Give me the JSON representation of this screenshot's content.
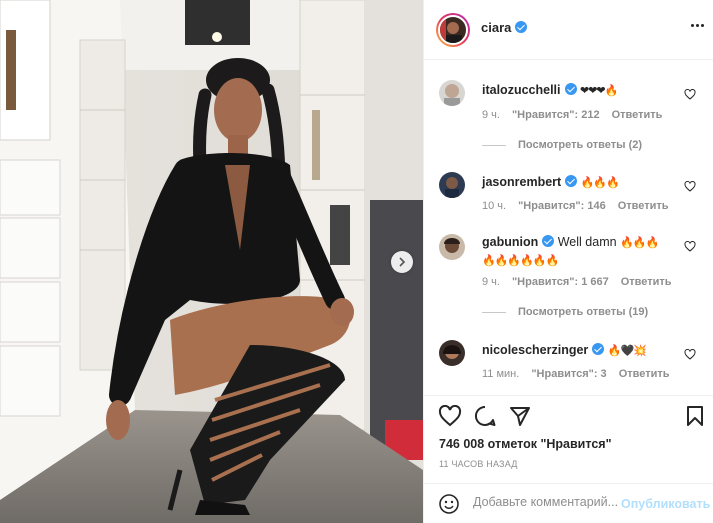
{
  "post": {
    "author": "ciara",
    "verified": true,
    "more_icon": "ellipsis-icon"
  },
  "comments": [
    {
      "user": "italozucchelli",
      "text": "",
      "emoji": "❤❤❤🔥",
      "age": "9 ч.",
      "likes": "\"Нравится\": 212",
      "reply": "Ответить",
      "view_replies": "Посмотреть ответы (2)"
    },
    {
      "user": "jasonrembert",
      "text": "",
      "emoji": "🔥🔥🔥",
      "age": "10 ч.",
      "likes": "\"Нравится\": 146",
      "reply": "Ответить",
      "view_replies": ""
    },
    {
      "user": "gabunion",
      "text": "Well damn",
      "emoji": "🔥🔥🔥",
      "emoji2": "🔥🔥🔥🔥🔥🔥",
      "age": "9 ч.",
      "likes": "\"Нравится\": 1 667",
      "reply": "Ответить",
      "view_replies": "Посмотреть ответы (19)"
    },
    {
      "user": "nicolescherzinger",
      "text": "",
      "emoji": "🔥🖤💥",
      "age": "11 мин.",
      "likes": "\"Нравится\": 3",
      "reply": "Ответить",
      "view_replies": ""
    }
  ],
  "actions": {
    "icons": [
      "heart-icon",
      "comment-icon",
      "share-icon",
      "bookmark-icon"
    ],
    "likes_count": "746 008 отметок \"Нравится\"",
    "timestamp": "11 ЧАСОВ НАЗАД"
  },
  "composer": {
    "placeholder": "Добавьте комментарий...",
    "publish": "Опубликовать"
  },
  "colors": {
    "accent": "#3897f0",
    "publish_disabled": "#b2dffc",
    "heart": "#ed4956",
    "muted": "#8e8e8e"
  }
}
